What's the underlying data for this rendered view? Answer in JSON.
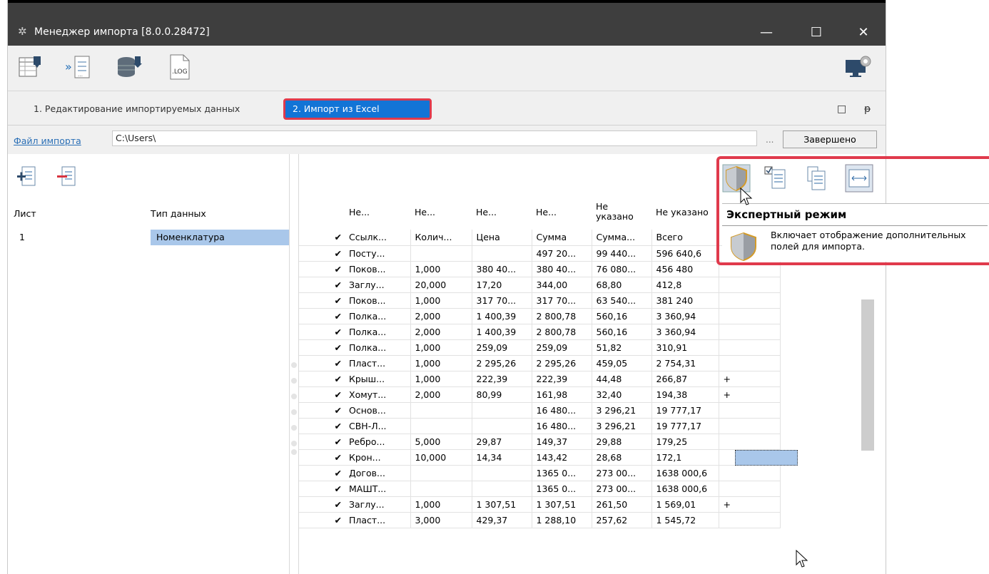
{
  "window": {
    "title": "Менеджер импорта [8.0.0.28472]",
    "controls": {
      "minimize": "—",
      "maximize": "☐",
      "close": "✕"
    }
  },
  "toolbar": {
    "icons": [
      "import-table-icon",
      "import-arrows-icon",
      "database-import-icon",
      "log-file-icon"
    ],
    "log_label": ".LOG",
    "right_icon": "monitor-settings-icon"
  },
  "tabs": {
    "items": [
      {
        "label": "1. Редактирование импортируемых данных",
        "active": false
      },
      {
        "label": "2. Импорт из Excel",
        "active": true
      }
    ],
    "restore": "□",
    "pin": "ᵽ"
  },
  "file": {
    "link_label": "Файл импорта",
    "path": "C:\\Users\\",
    "browse": "...",
    "done_button": "Завершено"
  },
  "left_panel": {
    "col_sheet": "Лист",
    "col_type": "Тип данных",
    "rows": [
      {
        "sheet": "1",
        "type": "Номенклатура"
      }
    ]
  },
  "grid": {
    "headers": [
      "Не...",
      "Не...",
      "Не...",
      "Не...",
      "Не\nуказано",
      "Не указано"
    ],
    "subheaders": [
      "Ссылк...",
      "Колич...",
      "Цена",
      "Сумма",
      "Сумма...",
      "Всего"
    ],
    "rows": [
      [
        "Посту...",
        "",
        "",
        "497 20...",
        "99 440...",
        "596 640,6",
        ""
      ],
      [
        "Поков...",
        "1,000",
        "380 40...",
        "380 40...",
        "76 080...",
        "456 480",
        ""
      ],
      [
        "Заглу...",
        "20,000",
        "17,20",
        "344,00",
        "68,80",
        "412,8",
        ""
      ],
      [
        "Поков...",
        "1,000",
        "317 70...",
        "317 70...",
        "63 540...",
        "381 240",
        ""
      ],
      [
        "Полка...",
        "2,000",
        "1 400,39",
        "2 800,78",
        "560,16",
        "3 360,94",
        ""
      ],
      [
        "Полка...",
        "2,000",
        "1 400,39",
        "2 800,78",
        "560,16",
        "3 360,94",
        ""
      ],
      [
        "Полка...",
        "1,000",
        "259,09",
        "259,09",
        "51,82",
        "310,91",
        ""
      ],
      [
        "Пласт...",
        "1,000",
        "2 295,26",
        "2 295,26",
        "459,05",
        "2 754,31",
        ""
      ],
      [
        "Крыш...",
        "1,000",
        "222,39",
        "222,39",
        "44,48",
        "266,87",
        "+"
      ],
      [
        "Хомут...",
        "2,000",
        "80,99",
        "161,98",
        "32,40",
        "194,38",
        "+"
      ],
      [
        "Основ...",
        "",
        "",
        "16 480...",
        "3 296,21",
        "19 777,17",
        ""
      ],
      [
        "СВН-Л...",
        "",
        "",
        "16 480...",
        "3 296,21",
        "19 777,17",
        ""
      ],
      [
        "Ребро...",
        "5,000",
        "29,87",
        "149,37",
        "29,88",
        "179,25",
        ""
      ],
      [
        "Крон...",
        "10,000",
        "14,34",
        "143,42",
        "28,68",
        "172,1",
        ""
      ],
      [
        "Догов...",
        "",
        "",
        "1365 0...",
        "273 00...",
        "1638 000,6",
        ""
      ],
      [
        "МАШТ...",
        "",
        "",
        "1365 0...",
        "273 00...",
        "1638 000,6",
        ""
      ],
      [
        "Заглу...",
        "1,000",
        "1 307,51",
        "1 307,51",
        "261,50",
        "1 569,01",
        "+"
      ],
      [
        "Пласт...",
        "3,000",
        "429,37",
        "1 288,10",
        "257,62",
        "1 545,72",
        ""
      ]
    ],
    "check": "✔"
  },
  "tooltip": {
    "title": "Экспертный режим",
    "text": "Включает отображение дополнительных полей для импорта."
  },
  "colors": {
    "accent": "#1274d6",
    "highlight": "#e03a4c",
    "selection": "#a9c7ea"
  }
}
